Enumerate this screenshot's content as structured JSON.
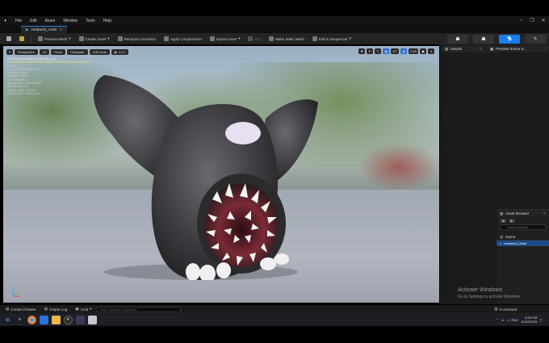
{
  "menu": {
    "items": [
      "File",
      "Edit",
      "Asset",
      "Window",
      "Tools",
      "Help"
    ],
    "window_controls": [
      "–",
      "❐",
      "✕"
    ]
  },
  "tab": {
    "label": "creature2_Anim"
  },
  "toolbar": {
    "save_icon": "save-icon",
    "preview_mesh": "Preview Mesh",
    "create_asset": "Create Asset",
    "reimport_animation": "Reimport Animation",
    "apply_compression": "Apply Compression",
    "export_asset": "Export Asset",
    "key": "Key",
    "make_static_mesh": "Make Static Mesh",
    "edit_in_sequencer": "Edit in Sequencer"
  },
  "viewport": {
    "perspective": "Perspective",
    "lit": "Lit",
    "show": "Show",
    "character": "Character",
    "lod": "LOD Auto",
    "speed": "x1.0",
    "right_icons": [
      "✥",
      "↻",
      "⤡",
      "▦",
      "10°",
      "▧",
      "0.25",
      "▣",
      "4"
    ],
    "stats": {
      "line1": "Previewing Animation creature2_Anim",
      "warn": "Skin Cache is disabled! Animating to fully support morph targets!",
      "lines": [
        "LOD: 0",
        "Current Screen Size: 1.04",
        "Triangles: 5,244",
        "Vertices: 3,218",
        "UV Channels: 1",
        "Approx Size: 119x110x116",
        "Num Bones: 44",
        "Frame: 0.000 / 45.000",
        "Time: 0.000 / 1.500 (sec)"
      ]
    }
  },
  "panels": {
    "details": "Details",
    "preview_scene": "Preview Scene S..."
  },
  "asset_browser": {
    "title": "Asset Browser",
    "search_placeholder": "Search Assets",
    "column_name": "Name",
    "selected_row": "creature2_Anim"
  },
  "watermark": {
    "title": "Activate Windows",
    "subtitle": "Go to Settings to activate Windows."
  },
  "bottombar": {
    "content_browser": "Content Drawer",
    "output_log": "Output Log",
    "cmd": "Cmd",
    "cmd_placeholder": "Enter Console Command",
    "unsaved": "5 Unsaved"
  },
  "taskbar": {
    "lang": "ENG",
    "time": "6:28 PM",
    "date": "12/24/2023"
  },
  "colors": {
    "accent": "#1a7df0",
    "selection": "#1c4a87"
  }
}
